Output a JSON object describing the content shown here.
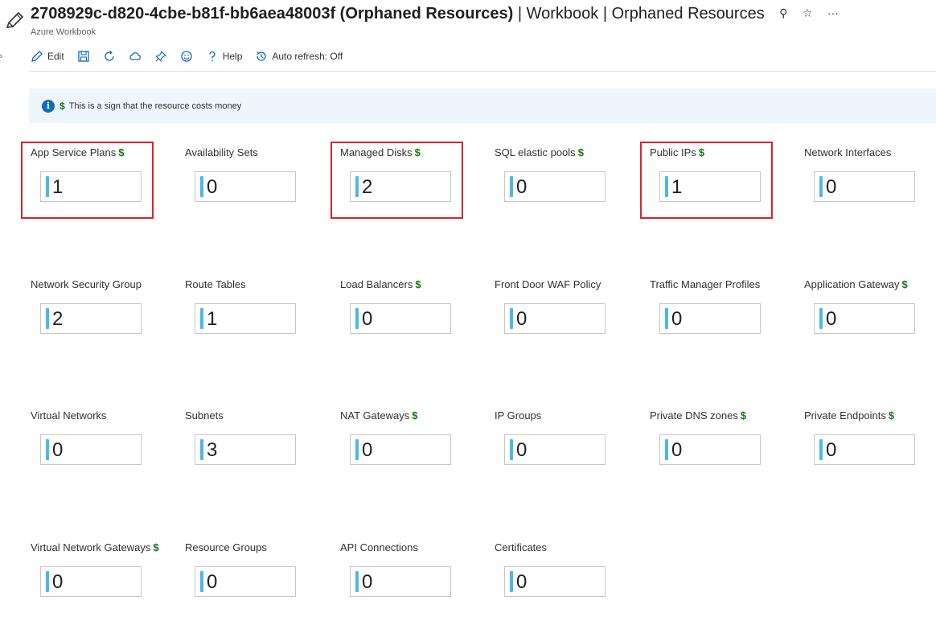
{
  "header": {
    "title_bold": "2708929c-d820-4cbe-b81f-bb6aea48003f (Orphaned Resources)",
    "title_rest": " | Workbook | Orphaned Resources",
    "subtitle": "Azure Workbook",
    "pin_glyph": "⚲",
    "star_glyph": "☆",
    "more_glyph": "···"
  },
  "toolbar": {
    "edit_label": "Edit",
    "help_label": "Help",
    "autorefresh_label": "Auto refresh: Off"
  },
  "info": {
    "icon_glyph": "i",
    "dollar_glyph": "$",
    "text": "This is a sign that the resource costs money"
  },
  "tiles": [
    {
      "label": "App Service Plans",
      "value": "1",
      "costs_money": true,
      "highlighted": true
    },
    {
      "label": "Availability Sets",
      "value": "0",
      "costs_money": false,
      "highlighted": false
    },
    {
      "label": "Managed Disks",
      "value": "2",
      "costs_money": true,
      "highlighted": true
    },
    {
      "label": "SQL elastic pools",
      "value": "0",
      "costs_money": true,
      "highlighted": false
    },
    {
      "label": "Public IPs",
      "value": "1",
      "costs_money": true,
      "highlighted": true
    },
    {
      "label": "Network Interfaces",
      "value": "0",
      "costs_money": false,
      "highlighted": false
    },
    {
      "label": "Network Security Group",
      "value": "2",
      "costs_money": false,
      "highlighted": false
    },
    {
      "label": "Route Tables",
      "value": "1",
      "costs_money": false,
      "highlighted": false
    },
    {
      "label": "Load Balancers",
      "value": "0",
      "costs_money": true,
      "highlighted": false
    },
    {
      "label": "Front Door WAF Policy",
      "value": "0",
      "costs_money": false,
      "highlighted": false
    },
    {
      "label": "Traffic Manager Profiles",
      "value": "0",
      "costs_money": false,
      "highlighted": false
    },
    {
      "label": "Application Gateway",
      "value": "0",
      "costs_money": true,
      "highlighted": false
    },
    {
      "label": "Virtual Networks",
      "value": "0",
      "costs_money": false,
      "highlighted": false
    },
    {
      "label": "Subnets",
      "value": "3",
      "costs_money": false,
      "highlighted": false
    },
    {
      "label": "NAT Gateways",
      "value": "0",
      "costs_money": true,
      "highlighted": false
    },
    {
      "label": "IP Groups",
      "value": "0",
      "costs_money": false,
      "highlighted": false
    },
    {
      "label": "Private DNS zones",
      "value": "0",
      "costs_money": true,
      "highlighted": false
    },
    {
      "label": "Private Endpoints",
      "value": "0",
      "costs_money": true,
      "highlighted": false
    },
    {
      "label": "Virtual Network Gateways",
      "value": "0",
      "costs_money": true,
      "highlighted": false
    },
    {
      "label": "Resource Groups",
      "value": "0",
      "costs_money": false,
      "highlighted": false
    },
    {
      "label": "API Connections",
      "value": "0",
      "costs_money": false,
      "highlighted": false
    },
    {
      "label": "Certificates",
      "value": "0",
      "costs_money": false,
      "highlighted": false
    }
  ],
  "colors": {
    "highlight": "#d9232e",
    "value_bar": "#4db8e8",
    "dollar": "#107c10",
    "info_bg": "#eef5fd"
  }
}
